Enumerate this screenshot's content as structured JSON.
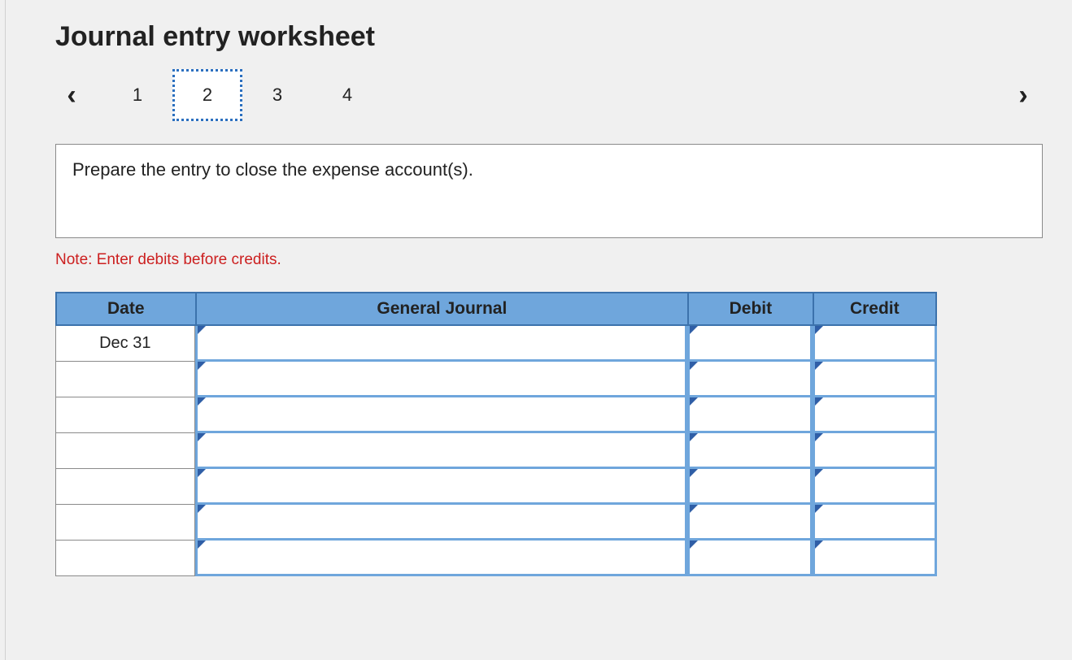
{
  "title": "Journal entry worksheet",
  "nav": {
    "prev_glyph": "‹",
    "next_glyph": "›",
    "tabs": [
      "1",
      "2",
      "3",
      "4"
    ],
    "active_index": 1
  },
  "instruction": "Prepare the entry to close the expense account(s).",
  "note": "Note: Enter debits before credits.",
  "table": {
    "headers": {
      "date": "Date",
      "journal": "General Journal",
      "debit": "Debit",
      "credit": "Credit"
    },
    "rows": [
      {
        "date": "Dec 31",
        "journal": "",
        "debit": "",
        "credit": ""
      },
      {
        "date": "",
        "journal": "",
        "debit": "",
        "credit": ""
      },
      {
        "date": "",
        "journal": "",
        "debit": "",
        "credit": ""
      },
      {
        "date": "",
        "journal": "",
        "debit": "",
        "credit": ""
      },
      {
        "date": "",
        "journal": "",
        "debit": "",
        "credit": ""
      },
      {
        "date": "",
        "journal": "",
        "debit": "",
        "credit": ""
      },
      {
        "date": "",
        "journal": "",
        "debit": "",
        "credit": ""
      }
    ]
  }
}
